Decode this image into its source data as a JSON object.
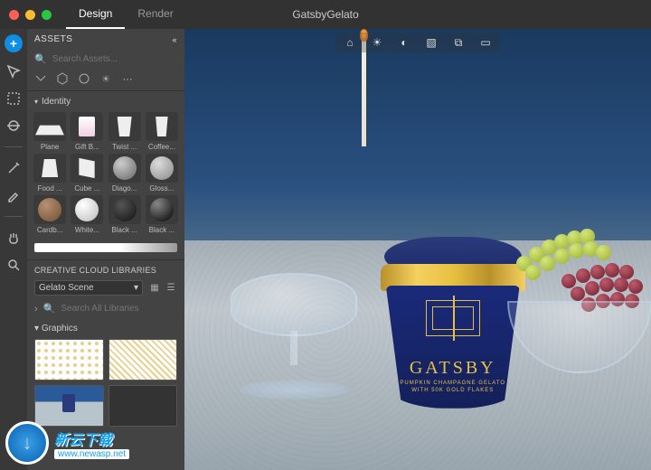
{
  "window": {
    "tabs": {
      "design": "Design",
      "render": "Render"
    },
    "document_title": "GatsbyGelato"
  },
  "panel": {
    "title": "ASSETS",
    "search_placeholder": "Search Assets...",
    "group_label": "Identity",
    "assets": [
      {
        "label": "Plane"
      },
      {
        "label": "Gift B..."
      },
      {
        "label": "Twist ..."
      },
      {
        "label": "Coffee..."
      },
      {
        "label": "Food ..."
      },
      {
        "label": "Cube ..."
      },
      {
        "label": "Diago..."
      },
      {
        "label": "Gloss..."
      },
      {
        "label": "Cardb..."
      },
      {
        "label": "White..."
      },
      {
        "label": "Black ..."
      },
      {
        "label": "Black ..."
      }
    ],
    "libraries_title": "CREATIVE CLOUD LIBRARIES",
    "library_selected": "Gelato Scene",
    "library_search_placeholder": "Search All Libraries",
    "graphics_label": "Graphics"
  },
  "product": {
    "brand": "GATSBY",
    "line1": "PUMPKIN CHAMPAGNE GELATO",
    "line2": "WITH 50K GOLD FLAKES"
  },
  "watermark": {
    "cn": "新云下载",
    "url": "www.newasp.net"
  }
}
